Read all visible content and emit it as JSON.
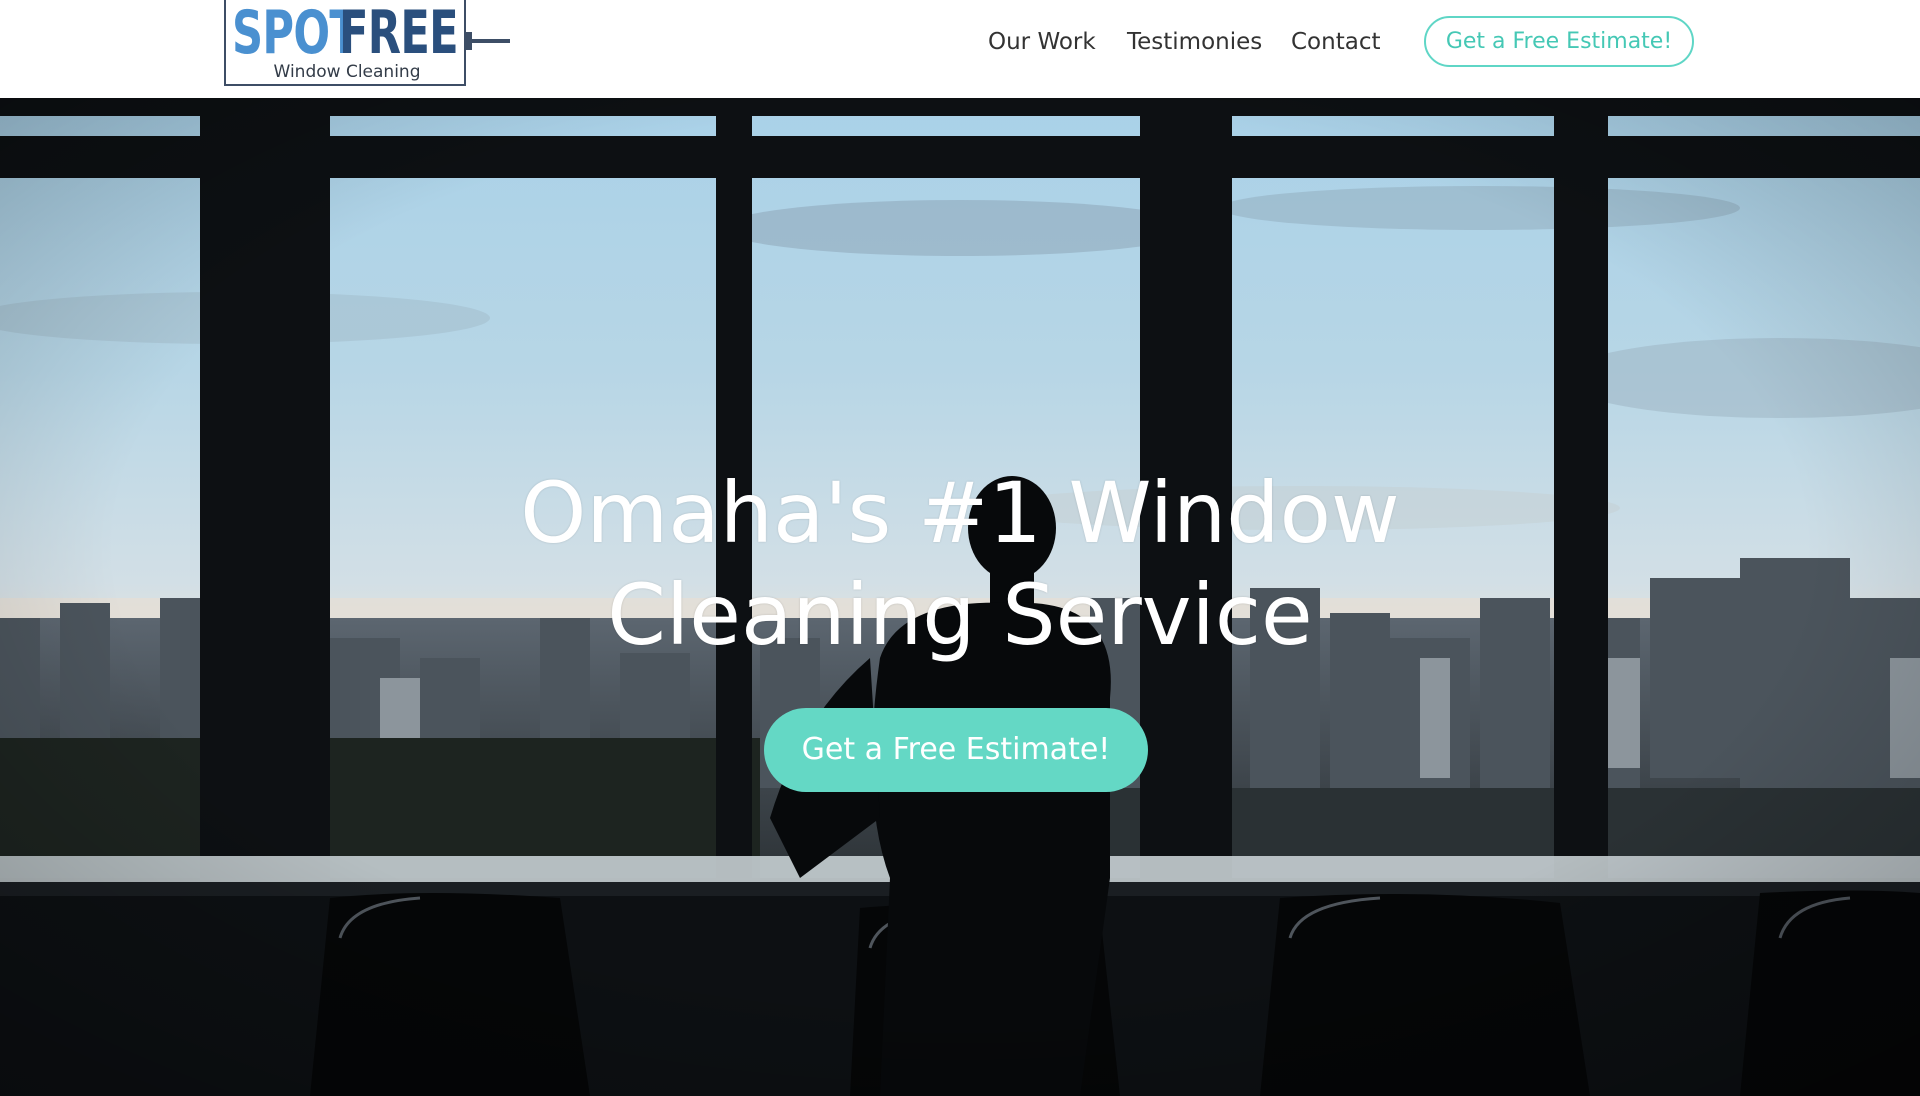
{
  "brand": {
    "name_part1": "SPOT",
    "name_part2": "FREE",
    "tagline": "Window Cleaning",
    "logo_icon": "squeegee-icon"
  },
  "nav": {
    "items": [
      {
        "label": "Our Work"
      },
      {
        "label": "Testimonies"
      },
      {
        "label": "Contact"
      }
    ],
    "cta_label": "Get a Free Estimate!"
  },
  "hero": {
    "title": "Omaha's #1 Window Cleaning Service",
    "cta_label": "Get a Free Estimate!"
  },
  "colors": {
    "accent": "#64d8c5",
    "accent_text": "#45c8b5",
    "logo_blue": "#4a90d0",
    "logo_navy": "#2a4f7d",
    "nav_text": "#333333"
  }
}
